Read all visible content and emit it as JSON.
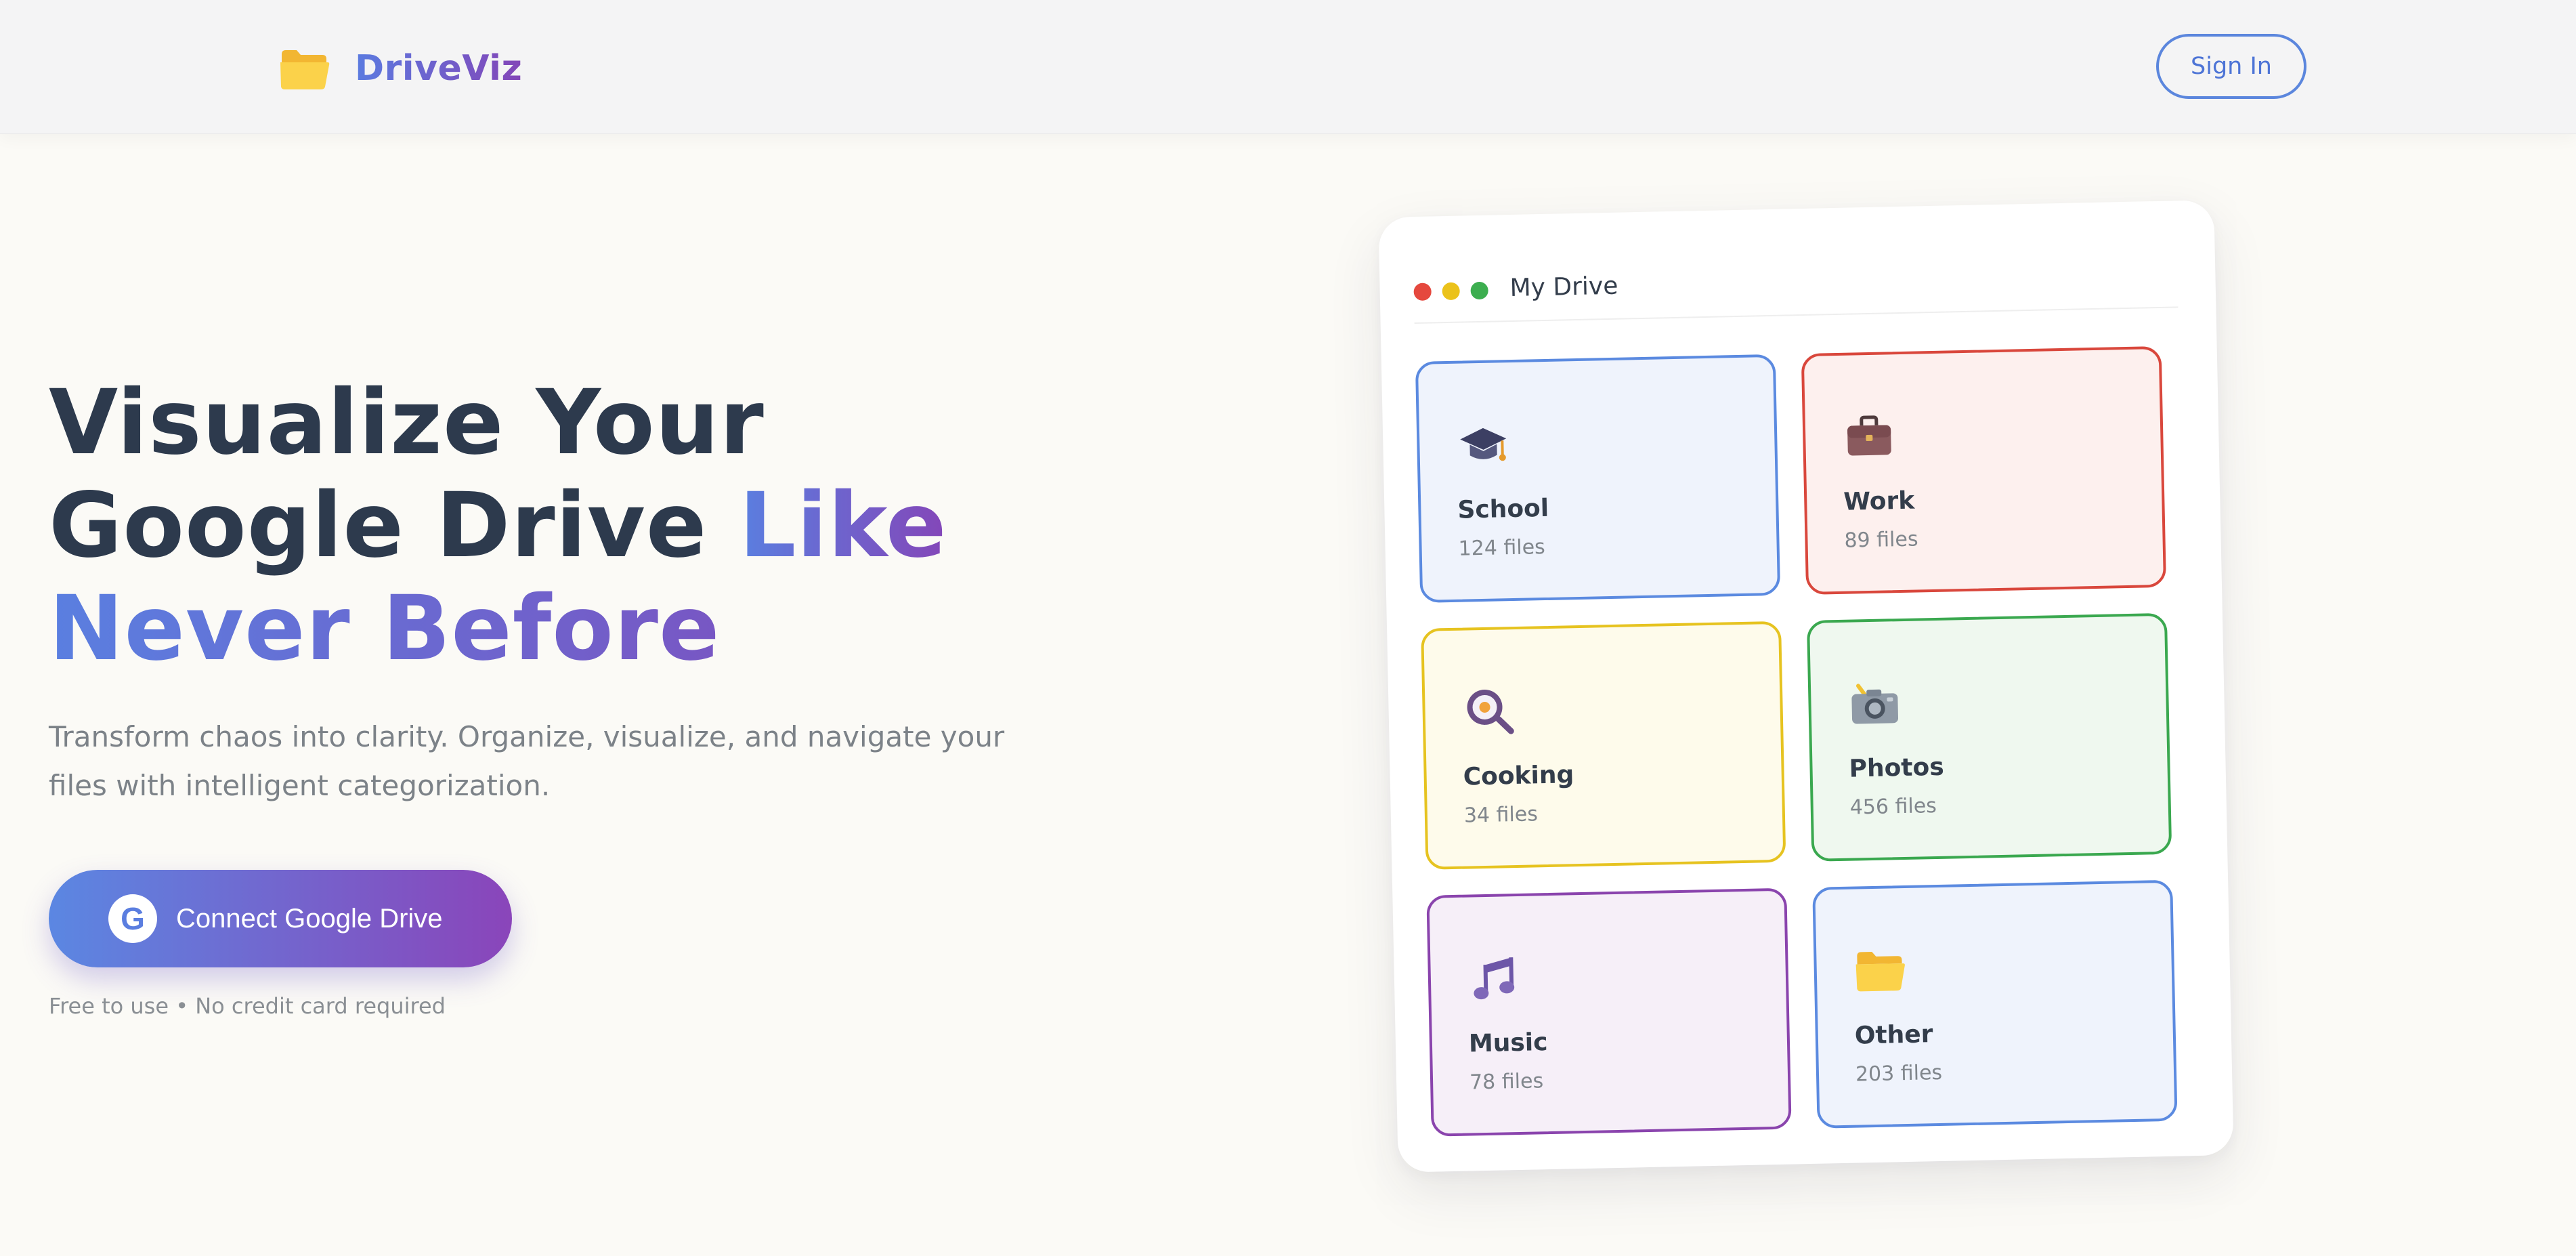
{
  "nav": {
    "brand": "DriveViz",
    "logo_icon": "folder-icon",
    "signin_label": "Sign In"
  },
  "hero": {
    "title_line1": "Visualize Your",
    "title_line2_plain": "Google Drive ",
    "title_line2_accent": "Like",
    "title_line3_accent": "Never Before",
    "subtitle": "Transform chaos into clarity. Organize, visualize, and navigate your files with intelligent categorization.",
    "cta_icon_letter": "G",
    "cta_label": "Connect Google Drive",
    "fineprint": "Free to use • No credit card required"
  },
  "drive": {
    "title": "My Drive",
    "window_dots": [
      "#e5483e",
      "#ebc21a",
      "#3cae4f"
    ],
    "folders": [
      {
        "name": "School",
        "count": "124 files",
        "icon": "graduation-cap-icon",
        "border": "#5b8ae0",
        "bg": "#eff3fc"
      },
      {
        "name": "Work",
        "count": "89 files",
        "icon": "briefcase-icon",
        "border": "#d9473c",
        "bg": "#fdf0ee"
      },
      {
        "name": "Cooking",
        "count": "34 files",
        "icon": "frying-pan-icon",
        "border": "#e6c320",
        "bg": "#fefbeb"
      },
      {
        "name": "Photos",
        "count": "456 files",
        "icon": "camera-icon",
        "border": "#3aa84f",
        "bg": "#eff8ef"
      },
      {
        "name": "Music",
        "count": "78 files",
        "icon": "music-note-icon",
        "border": "#8a44ad",
        "bg": "#f6eff8"
      },
      {
        "name": "Other",
        "count": "203 files",
        "icon": "folder-icon",
        "border": "#5b8ae0",
        "bg": "#eff3fc"
      }
    ]
  }
}
